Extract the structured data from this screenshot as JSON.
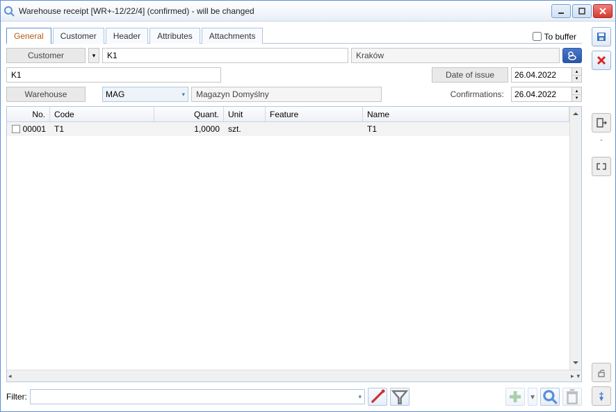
{
  "window": {
    "title": "Warehouse receipt [WR+-12/22/4] (confirmed) - will be changed"
  },
  "tabs": {
    "general": "General",
    "customer": "Customer",
    "header": "Header",
    "attributes": "Attributes",
    "attachments": "Attachments",
    "to_buffer": "To buffer"
  },
  "labels": {
    "customer": "Customer",
    "warehouse": "Warehouse",
    "date_of_issue": "Date of issue",
    "confirmations": "Confirmations:",
    "filter": "Filter:"
  },
  "fields": {
    "customer_code": "K1",
    "customer_city": "Kraków",
    "customer_name": "K1",
    "warehouse_code": "MAG",
    "warehouse_name": "Magazyn Domyślny",
    "date_of_issue": "26.04.2022",
    "confirmation_date": "26.04.2022",
    "filter_value": ""
  },
  "table": {
    "headers": {
      "no": "No.",
      "code": "Code",
      "quant": "Quant.",
      "unit": "Unit",
      "feature": "Feature",
      "name": "Name"
    },
    "rows": [
      {
        "no": "00001",
        "code": "T1",
        "quant": "1,0000",
        "unit": "szt.",
        "feature": "",
        "name": "T1"
      }
    ]
  },
  "icons": {
    "save": "save-icon",
    "cancel": "close-icon",
    "customer_lookup": "customer-lookup-icon",
    "export": "export-icon",
    "expand": "expand-icon",
    "add": "add-icon",
    "search": "search-icon",
    "delete": "trash-icon",
    "lock": "lock-icon",
    "pin": "pin-icon",
    "wand": "wand-icon",
    "funnel": "funnel-icon"
  }
}
